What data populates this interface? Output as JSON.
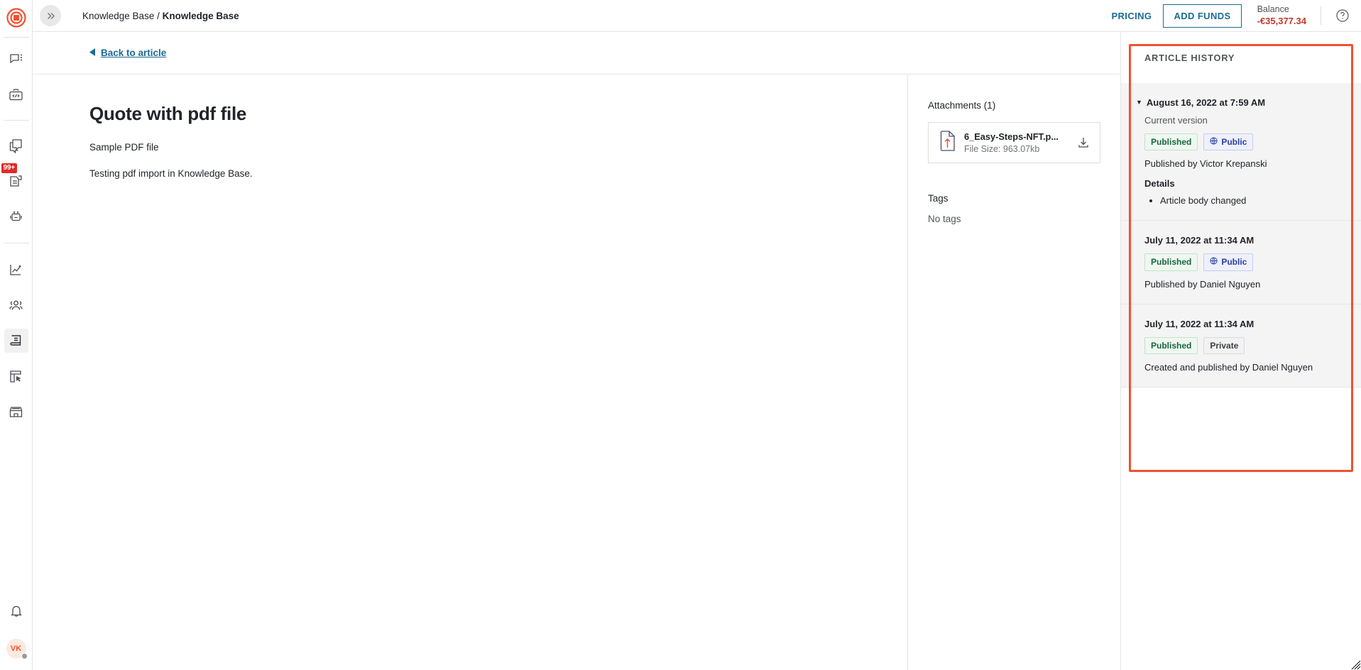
{
  "topbar": {
    "collapse_icon": "chevron-double-right-icon",
    "breadcrumb": {
      "root": "Knowledge Base",
      "separator": "/",
      "current": "Knowledge Base"
    },
    "pricing_label": "PRICING",
    "add_funds_label": "ADD FUNDS",
    "balance_label": "Balance",
    "balance_value": "-€35,377.34",
    "balance_color": "#c0392b",
    "help_icon": "question-circle-icon"
  },
  "sidebar": {
    "logo_icon": "app-logo-icon",
    "logo_color": "#f1502f",
    "items": [
      {
        "name": "chat-menu-icon",
        "label": "Conversations",
        "active": false
      },
      {
        "name": "toolbox-code-icon",
        "label": "Developer Tools",
        "active": false
      },
      {
        "name": "copy-chat-icon",
        "label": "Canned Responses",
        "active": false
      },
      {
        "name": "saved-reply-icon",
        "label": "Saved Replies",
        "active": false,
        "badge": "99+"
      },
      {
        "name": "chatbot-icon",
        "label": "Chatbot",
        "active": false
      },
      {
        "name": "analytics-icon",
        "label": "Reports",
        "active": false
      },
      {
        "name": "contacts-icon",
        "label": "Contacts",
        "active": false
      },
      {
        "name": "knowledge-base-icon",
        "label": "Knowledge Base",
        "active": true
      },
      {
        "name": "widget-cursor-icon",
        "label": "Widget",
        "active": false
      },
      {
        "name": "storefront-icon",
        "label": "Store",
        "active": false
      }
    ],
    "notifications_icon": "bell-icon",
    "avatar_initials": "VK",
    "avatar_status": "offline"
  },
  "main": {
    "back_label": "Back to article",
    "back_icon": "triangle-left-icon",
    "article": {
      "title": "Quote with pdf file",
      "paragraphs": [
        "Sample PDF file",
        "Testing pdf import in Knowledge Base."
      ]
    },
    "meta": {
      "attachments_heading": "Attachments (1)",
      "attachments": [
        {
          "icon": "pdf-upload-file-icon",
          "name": "6_Easy-Steps-NFT.p...",
          "size": "File Size: 963.07kb",
          "download_icon": "download-icon"
        }
      ],
      "tags_heading": "Tags",
      "tags_value": "No tags"
    }
  },
  "history": {
    "heading": "ARTICLE HISTORY",
    "highlight_color": "#f1502f",
    "entries": [
      {
        "expanded": true,
        "date": "August 16, 2022 at 7:59 AM",
        "subtitle": "Current version",
        "badges": [
          {
            "label": "Published",
            "type": "published"
          },
          {
            "label": "Public",
            "type": "public",
            "icon": "globe-icon"
          }
        ],
        "author_line": "Published by Victor Krepanski",
        "details_heading": "Details",
        "details": [
          "Article body changed"
        ]
      },
      {
        "expanded": false,
        "date": "July 11, 2022 at 11:34 AM",
        "badges": [
          {
            "label": "Published",
            "type": "published"
          },
          {
            "label": "Public",
            "type": "public",
            "icon": "globe-icon"
          }
        ],
        "author_line": "Published by Daniel Nguyen"
      },
      {
        "expanded": false,
        "date": "July 11, 2022 at 11:34 AM",
        "badges": [
          {
            "label": "Published",
            "type": "published"
          },
          {
            "label": "Private",
            "type": "private"
          }
        ],
        "author_line": "Created and published by Daniel Nguyen"
      }
    ]
  }
}
